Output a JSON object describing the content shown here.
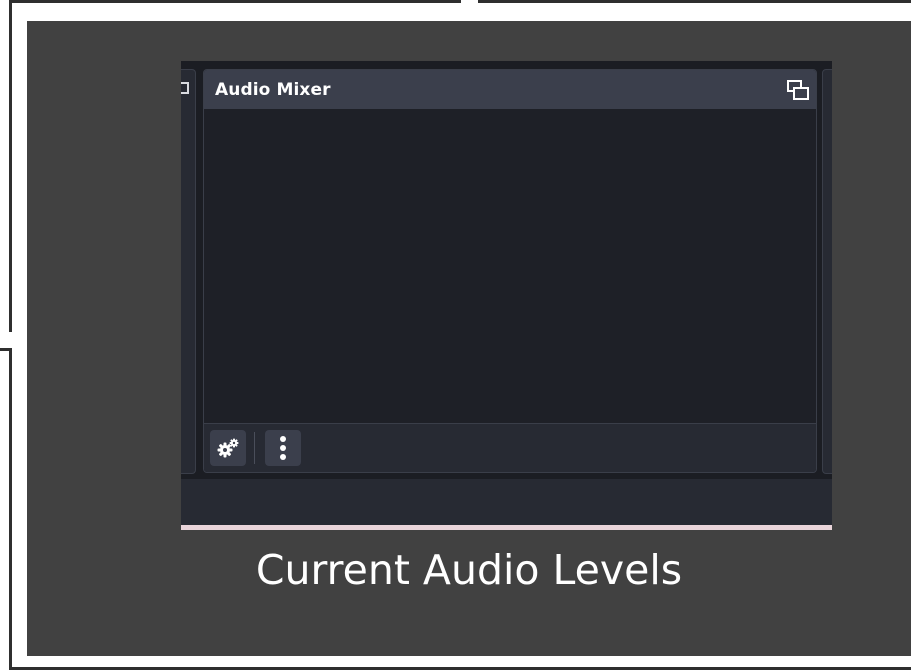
{
  "panel": {
    "title": "Audio Mixer",
    "header_icon": "undock-icon",
    "footer_buttons": [
      {
        "icon": "gears-icon",
        "action": "advanced-audio-properties"
      },
      {
        "icon": "vertical-ellipsis-icon",
        "action": "more-options"
      }
    ]
  },
  "caption": "Current Audio Levels",
  "colors": {
    "slide_background": "#414141",
    "panel_header": "#3b3f4c",
    "panel_body": "#1e2027",
    "accent_strip": "#e9d4da",
    "text": "#ffffff"
  }
}
